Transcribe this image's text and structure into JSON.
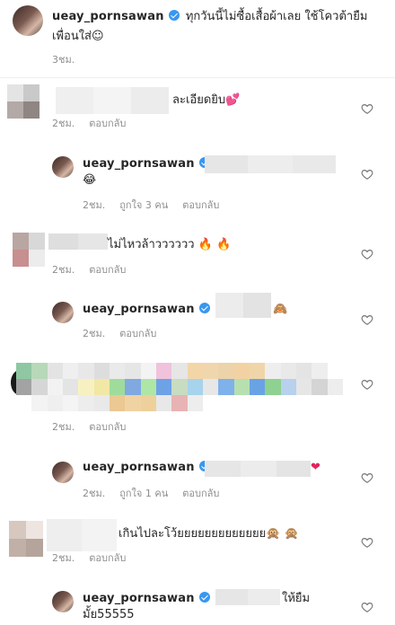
{
  "post": {
    "username": "ueay_pornsawan",
    "caption_line1": "ทุกวันนี้ไม่ซื้อเสื้อผ้าเลย ใช้โควต้ายืม",
    "caption_line2": "เพื่อนใส่",
    "caption_emoji": "☺",
    "time": "3ชม."
  },
  "comments": [
    {
      "text": "ละเอียดยิบ",
      "emoji": "💕",
      "time": "2ชม.",
      "reply": "ตอบกลับ"
    },
    {
      "username": "ueay_pornsawan",
      "emoji": "😂",
      "time": "2ชม.",
      "likes": "ถูกใจ 3 คน",
      "reply": "ตอบกลับ"
    },
    {
      "text": "ไม่ไหวล้าวววววว",
      "emoji": "🔥 🔥",
      "time": "2ชม.",
      "reply": "ตอบกลับ"
    },
    {
      "username": "ueay_pornsawan",
      "prefix": "@",
      "emoji": "🙈",
      "time": "2ชม.",
      "reply": "ตอบกลับ"
    },
    {
      "time": "2ชม.",
      "reply": "ตอบกลับ"
    },
    {
      "username": "ueay_pornsawan",
      "emoji": "❤",
      "time": "2ชม.",
      "likes": "ถูกใจ 1 คน",
      "reply": "ตอบกลับ"
    },
    {
      "text": "เกินไปละโว้ยยยยยยยยยยยยย",
      "emoji": "🙊 🙊",
      "time": "2ชม.",
      "reply": "ตอบกลับ"
    },
    {
      "username": "ueay_pornsawan",
      "prefix": "@",
      "text_after": "ให้ยืม",
      "text_line2": "มั้ย55555"
    }
  ],
  "icons": {
    "heart": "heart-outline-icon",
    "verified": "verified-badge-icon"
  },
  "colors": {
    "verified": "#3897f0",
    "meta": "#8e8e8e",
    "text": "#262626"
  }
}
